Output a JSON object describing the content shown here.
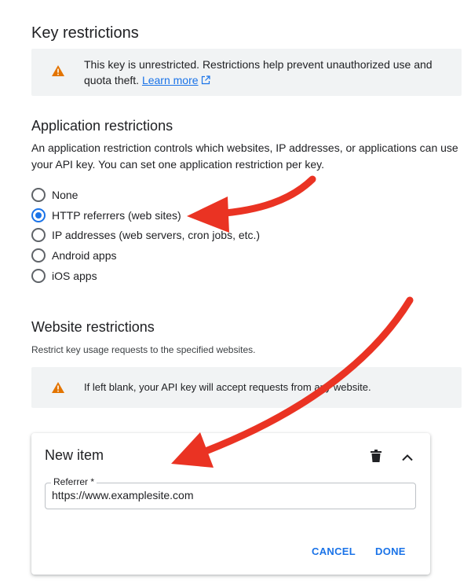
{
  "key_restrictions": {
    "title": "Key restrictions",
    "banner": {
      "icon": "warning-icon",
      "text": "This key is unrestricted. Restrictions help prevent unauthorized use and quota theft.",
      "link_label": "Learn more",
      "link_icon": "external-link-icon"
    }
  },
  "application_restrictions": {
    "title": "Application restrictions",
    "description": "An application restriction controls which websites, IP addresses, or applications can use your API key. You can set one application restriction per key.",
    "options": [
      {
        "label": "None",
        "selected": false
      },
      {
        "label": "HTTP referrers (web sites)",
        "selected": true
      },
      {
        "label": "IP addresses (web servers, cron jobs, etc.)",
        "selected": false
      },
      {
        "label": "Android apps",
        "selected": false
      },
      {
        "label": "iOS apps",
        "selected": false
      }
    ]
  },
  "website_restrictions": {
    "title": "Website restrictions",
    "description": "Restrict key usage requests to the specified websites.",
    "banner": {
      "icon": "warning-icon",
      "text": "If left blank, your API key will accept requests from any website."
    }
  },
  "new_item": {
    "title": "New item",
    "delete_icon": "trash-icon",
    "collapse_icon": "chevron-up-icon",
    "field_label": "Referrer *",
    "field_value": "https://www.examplesite.com",
    "cancel_label": "CANCEL",
    "done_label": "DONE"
  },
  "colors": {
    "accent": "#1a73e8",
    "warning": "#e37400",
    "annotation_arrow": "#ea3323",
    "banner_bg": "#f1f3f4"
  }
}
